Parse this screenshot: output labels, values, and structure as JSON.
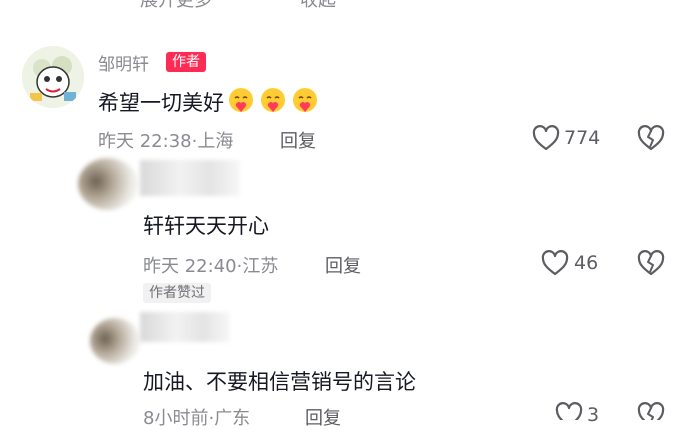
{
  "top_partial": {
    "expand_more": "展开更多",
    "hide": "收起"
  },
  "comment_main": {
    "username": "邹明轩",
    "badge": "作者",
    "text": "希望一切美好",
    "time": "昨天 22:38",
    "location": "上海",
    "reply_label": "回复",
    "likes": "774",
    "emoji_icons": [
      "kissing-heart-emoji",
      "kissing-heart-emoji",
      "kissing-heart-emoji"
    ]
  },
  "reply_1": {
    "text": "轩轩天天开心",
    "time": "昨天 22:40",
    "location": "江苏",
    "reply_label": "回复",
    "likes": "46",
    "liked_by_author": "作者赞过"
  },
  "reply_2": {
    "text": "加油、不要相信营销号的言论",
    "time": "8小时前",
    "location": "广东",
    "reply_label": "回复",
    "likes": "3"
  },
  "colors": {
    "accent": "#fe2c55",
    "muted": "#8a8b91",
    "text": "#161823"
  },
  "icons": {
    "like": "heart-outline-icon",
    "dislike": "broken-heart-icon"
  }
}
